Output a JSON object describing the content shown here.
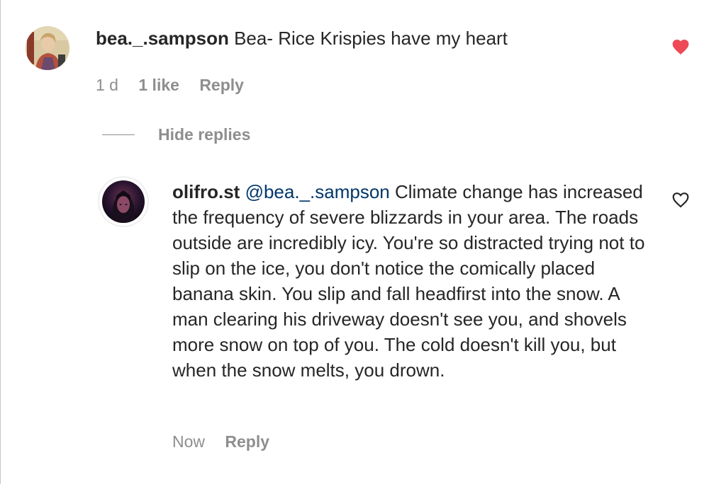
{
  "comment": {
    "username": "bea._.sampson",
    "text": " Bea- Rice Krispies have my heart",
    "time": "1 d",
    "likes": "1 like",
    "reply_label": "Reply",
    "liked": true,
    "like_color": "#ed4956"
  },
  "replies_toggle": {
    "label": "Hide replies"
  },
  "reply": {
    "username": "olifro.st",
    "mention": "@bea._.sampson",
    "text": " Climate change has increased the frequency of severe blizzards in your area. The roads outside are incredibly icy. You're so distracted trying not to slip on the ice, you don't notice the comically placed banana skin. You slip and fall headfirst into the snow. A man clearing his driveway doesn't see you, and shovels more snow on top of you. The cold doesn't kill you, but when the snow melts, you drown.",
    "time": "Now",
    "reply_label": "Reply",
    "liked": false
  },
  "icons": {
    "comment_like": "heart-filled-icon",
    "reply_like": "heart-outline-icon"
  }
}
